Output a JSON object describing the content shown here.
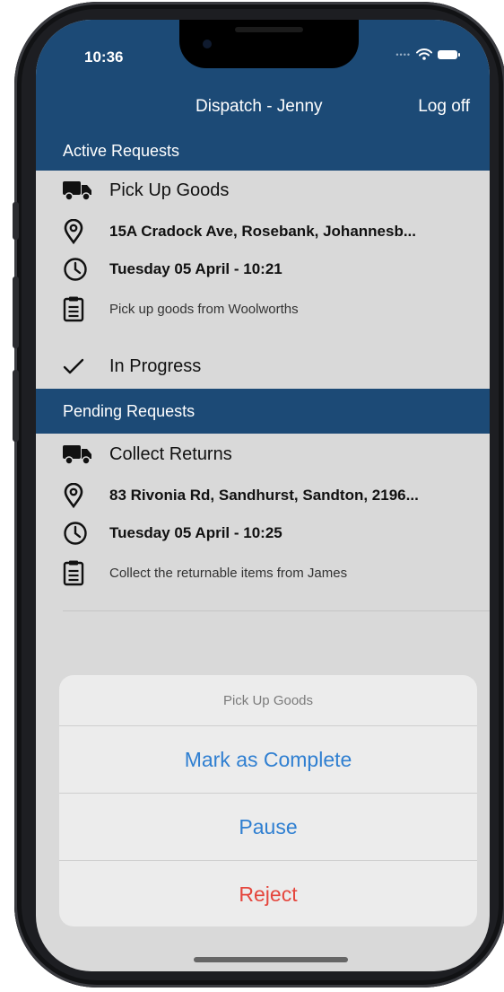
{
  "status_bar": {
    "time": "10:36"
  },
  "nav": {
    "title": "Dispatch - Jenny",
    "logoff_label": "Log off"
  },
  "active": {
    "header": "Active Requests",
    "item": {
      "type": "Pick Up Goods",
      "address": "15A Cradock Ave, Rosebank, Johannesb...",
      "datetime": "Tuesday 05 April - 10:21",
      "note": "Pick up goods from Woolworths",
      "status": "In Progress"
    }
  },
  "pending": {
    "header": "Pending Requests",
    "item": {
      "type": "Collect Returns",
      "address": "83 Rivonia Rd, Sandhurst, Sandton, 2196...",
      "datetime": "Tuesday 05 April - 10:25",
      "note": "Collect the returnable items from James"
    }
  },
  "action_sheet": {
    "title": "Pick Up Goods",
    "actions": [
      {
        "label": "Mark as Complete",
        "color": "#2f7fd1"
      },
      {
        "label": "Pause",
        "color": "#2f7fd1"
      },
      {
        "label": "Reject",
        "color": "#e5463d"
      }
    ]
  },
  "colors": {
    "nav_bar": "#1c4a76",
    "background": "#d9d9d9",
    "accent": "#2f7fd1",
    "destructive": "#e5463d"
  },
  "icons": [
    "truck-icon",
    "location-pin-icon",
    "clock-icon",
    "clipboard-icon",
    "checkmark-icon",
    "wifi-icon",
    "battery-icon"
  ]
}
